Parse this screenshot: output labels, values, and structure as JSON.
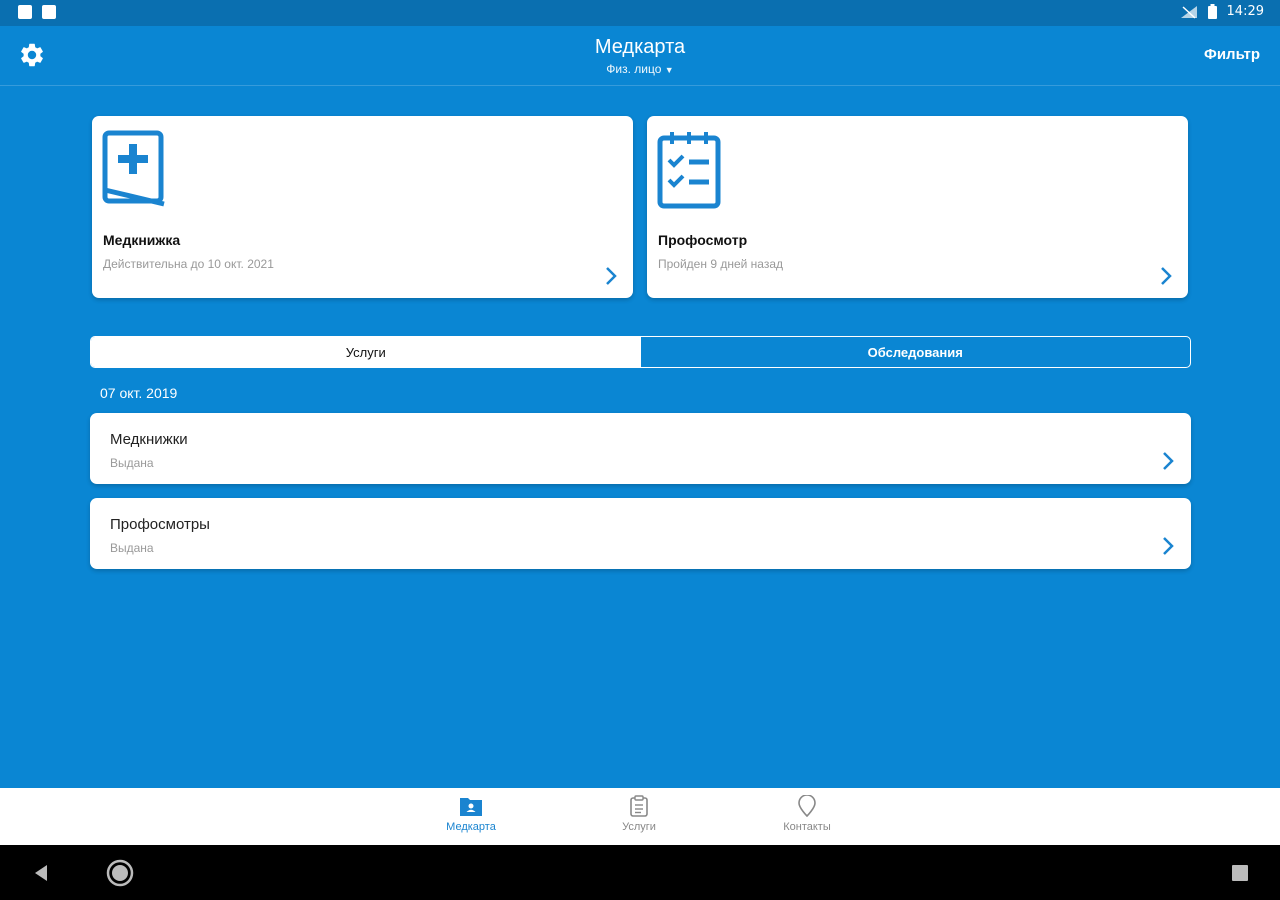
{
  "status_bar": {
    "time": "14:29"
  },
  "app_bar": {
    "title": "Медкарта",
    "subtitle": "Физ. лицо",
    "filter_label": "Фильтр"
  },
  "cards": [
    {
      "title": "Медкнижка",
      "subtitle": "Действительна до 10 окт. 2021"
    },
    {
      "title": "Профосмотр",
      "subtitle": "Пройден 9 дней назад"
    }
  ],
  "tabs": [
    {
      "label": "Услуги",
      "active": true
    },
    {
      "label": "Обследования",
      "active": false
    }
  ],
  "date_header": "07 окт. 2019",
  "list": [
    {
      "title": "Медкнижки",
      "status": "Выдана"
    },
    {
      "title": "Профосмотры",
      "status": "Выдана"
    }
  ],
  "bottom_nav": [
    {
      "label": "Медкарта",
      "icon": "medcard-folder-icon",
      "active": true
    },
    {
      "label": "Услуги",
      "icon": "clipboard-icon",
      "active": false
    },
    {
      "label": "Контакты",
      "icon": "location-pin-icon",
      "active": false
    }
  ],
  "colors": {
    "primary": "#0a86d3",
    "accent": "#1a84d0",
    "status_bar": "#0a6fb0"
  }
}
